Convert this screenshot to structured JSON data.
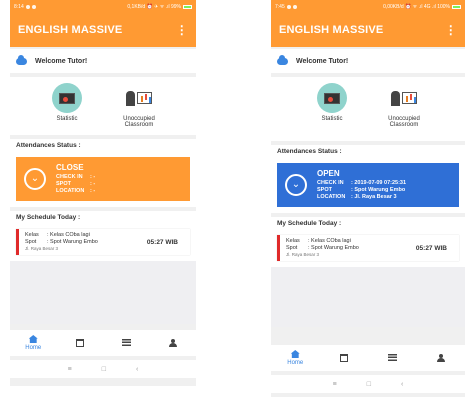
{
  "phone1": {
    "status_time": "8:14",
    "status_right": "0,1KB/d ⏰ ✈ ᯤ .ıl 99%",
    "app_title": "ENGLISH MASSIVE",
    "menu_icon": "⋮",
    "welcome": "Welcome Tutor!",
    "menu": [
      {
        "label": "Statistic",
        "icon": "statistic-board-icon"
      },
      {
        "label": "Unoccupied Classroom",
        "icon": "classroom-presentation-icon"
      }
    ],
    "attendance_title": "Attendances Status :",
    "attendance": {
      "status": "CLOSE",
      "color": "#ff9a33",
      "checkin_label": "CHECK IN",
      "checkin_value": ": -",
      "spot_label": "SPOT",
      "spot_value": ": -",
      "location_label": "LOCATION",
      "location_value": ": -"
    },
    "schedule_title": "My Schedule Today :",
    "schedule": {
      "kelas_label": "Kelas",
      "kelas_value": ": Kelas COba lagi",
      "spot_label": "Spot",
      "spot_value": ": Spot Warung Embo",
      "address": "Jl. Raya Besar 3",
      "time": "05:27 WIB"
    },
    "nav": {
      "home": "Home"
    },
    "sysnav": [
      "≡",
      "□",
      "‹"
    ]
  },
  "phone2": {
    "status_time": "7:45",
    "status_right": "0,00KB/d ⏰ ᯤ .ıl 4G .ıl 100%",
    "app_title": "ENGLISH MASSIVE",
    "menu_icon": "⋮",
    "welcome": "Welcome Tutor!",
    "menu": [
      {
        "label": "Statistic",
        "icon": "statistic-board-icon"
      },
      {
        "label": "Unoccupied Classroom",
        "icon": "classroom-presentation-icon"
      }
    ],
    "attendance_title": "Attendances Status :",
    "attendance": {
      "status": "OPEN",
      "color": "#2f6fd6",
      "checkin_label": "CHECK IN",
      "checkin_value": ": 2019-07-09 07:25:31",
      "spot_label": "SPOT",
      "spot_value": ": Spot Warung Embo",
      "location_label": "LOCATION",
      "location_value": ": Jl. Raya Besar 3"
    },
    "schedule_title": "My Schedule Today :",
    "schedule": {
      "kelas_label": "Kelas",
      "kelas_value": ": Kelas COba lagi",
      "spot_label": "Spot",
      "spot_value": ": Spot Warung Embo",
      "address": "Jl. Raya Besar 3",
      "time": "05:27 WIB"
    },
    "nav": {
      "home": "Home"
    },
    "sysnav": [
      "≡",
      "□",
      "‹"
    ]
  }
}
